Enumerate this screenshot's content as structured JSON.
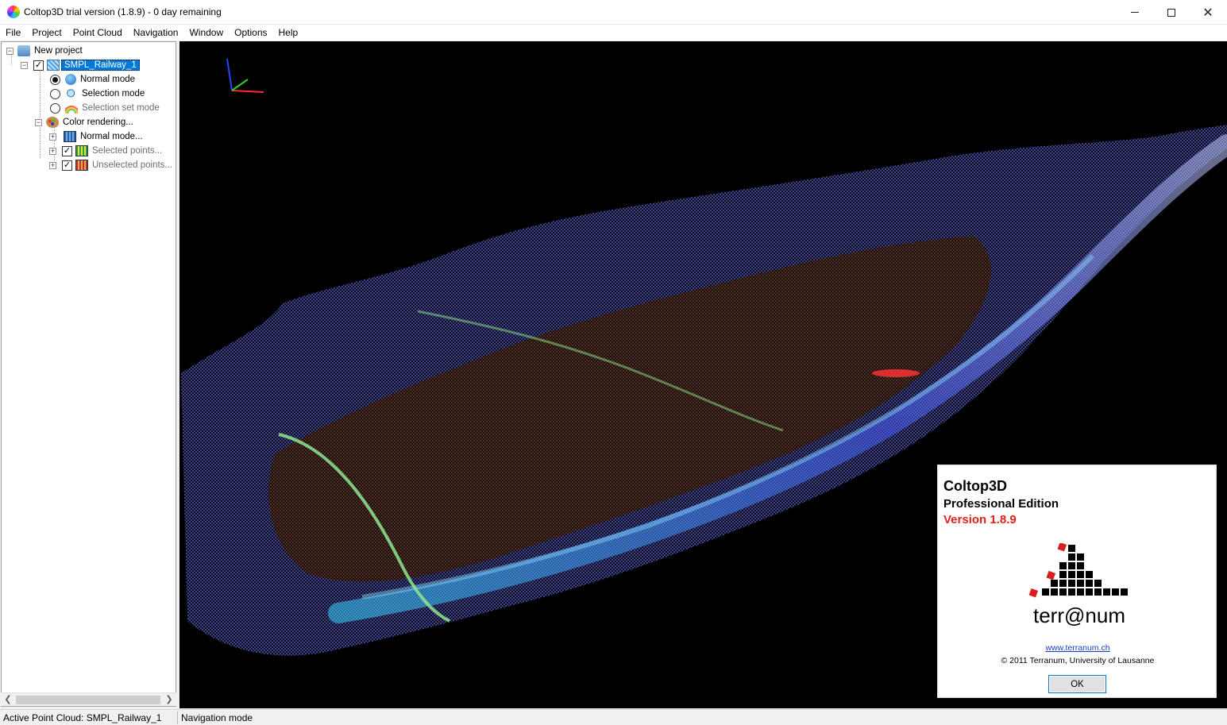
{
  "window": {
    "title": "Coltop3D trial version (1.8.9) - 0 day remaining",
    "minimize_label": "",
    "maximize_label": "",
    "close_label": "✕"
  },
  "menu": [
    "File",
    "Project",
    "Point Cloud",
    "Navigation",
    "Window",
    "Options",
    "Help"
  ],
  "tree": {
    "root": "New project",
    "cloud": "SMPL_Railway_1",
    "modes": {
      "normal": "Normal mode",
      "selection": "Selection mode",
      "selection_set": "Selection set mode"
    },
    "color_rendering": "Color rendering...",
    "color_children": {
      "normal": "Normal mode...",
      "selected": "Selected points...",
      "unselected": "Unselected points..."
    },
    "check_mark": "✓"
  },
  "about": {
    "title": "Coltop3D",
    "edition": "Professional Edition",
    "version": "Version 1.8.9",
    "logo_text": "terr@num",
    "url": "www.terranum.ch",
    "copyright": "© 2011 Terranum, University of Lausanne",
    "ok_label": "OK"
  },
  "status": {
    "left": "Active Point Cloud: SMPL_Railway_1",
    "right": "Navigation mode"
  },
  "colors": {
    "accent": "#0078d7",
    "version_red": "#e0211b",
    "link_blue": "#1a3cc8",
    "viewport_bg": "#000000"
  }
}
